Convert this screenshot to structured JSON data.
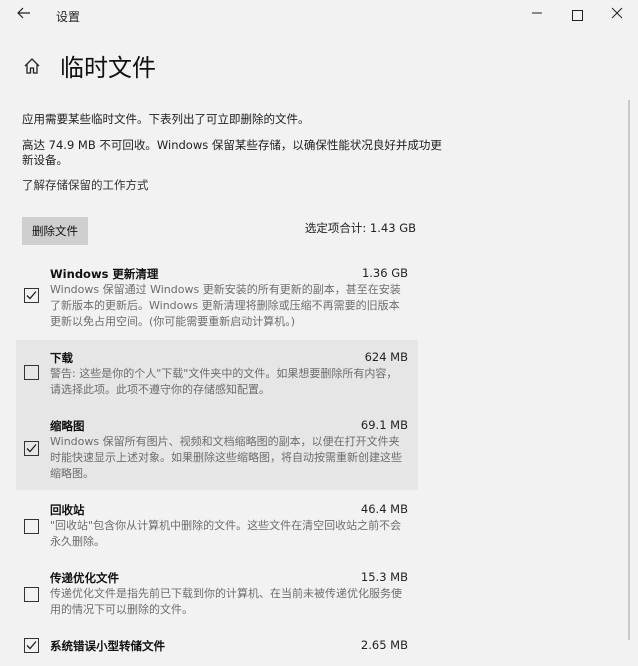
{
  "window": {
    "title": "设置",
    "back_icon": "back-arrow-icon",
    "minimize_icon": "minimize-icon",
    "maximize_icon": "maximize-icon",
    "close_icon": "close-icon"
  },
  "header": {
    "home_icon": "home-icon",
    "title": "临时文件"
  },
  "intro": {
    "line1": "应用需要某些临时文件。下表列出了可立即删除的文件。",
    "line2": "高达 74.9 MB 不可回收。Windows 保留某些存储，以确保性能状况良好并成功更新设备。",
    "link": "了解存储保留的工作方式"
  },
  "actions": {
    "delete_label": "删除文件",
    "selected_total": "选定项合计: 1.43 GB"
  },
  "items": [
    {
      "name": "Windows 更新清理",
      "size": "1.36 GB",
      "checked": true,
      "description": "Windows 保留通过 Windows 更新安装的所有更新的副本，甚至在安装了新版本的更新后。Windows 更新清理将删除或压缩不再需要的旧版本更新以免占用空间。(你可能需要重新启动计算机。)"
    },
    {
      "name": "下载",
      "size": "624 MB",
      "checked": false,
      "description": "警告: 这些是你的个人\"下载\"文件夹中的文件。如果想要删除所有内容，请选择此项。此项不遵守你的存储感知配置。"
    },
    {
      "name": "缩略图",
      "size": "69.1 MB",
      "checked": true,
      "description": "Windows 保留所有图片、视频和文档缩略图的副本，以便在打开文件夹时能快速显示上述对象。如果删除这些缩略图，将自动按需重新创建这些缩略图。"
    },
    {
      "name": "回收站",
      "size": "46.4 MB",
      "checked": false,
      "description": "\"回收站\"包含你从计算机中删除的文件。这些文件在清空回收站之前不会永久删除。"
    },
    {
      "name": "传递优化文件",
      "size": "15.3 MB",
      "checked": false,
      "description": "传递优化文件是指先前已下载到你的计算机、在当前未被传递优化服务使用的情况下可以删除的文件。"
    },
    {
      "name": "系统错误小型转储文件",
      "size": "2.65 MB",
      "checked": true,
      "description": ""
    }
  ]
}
